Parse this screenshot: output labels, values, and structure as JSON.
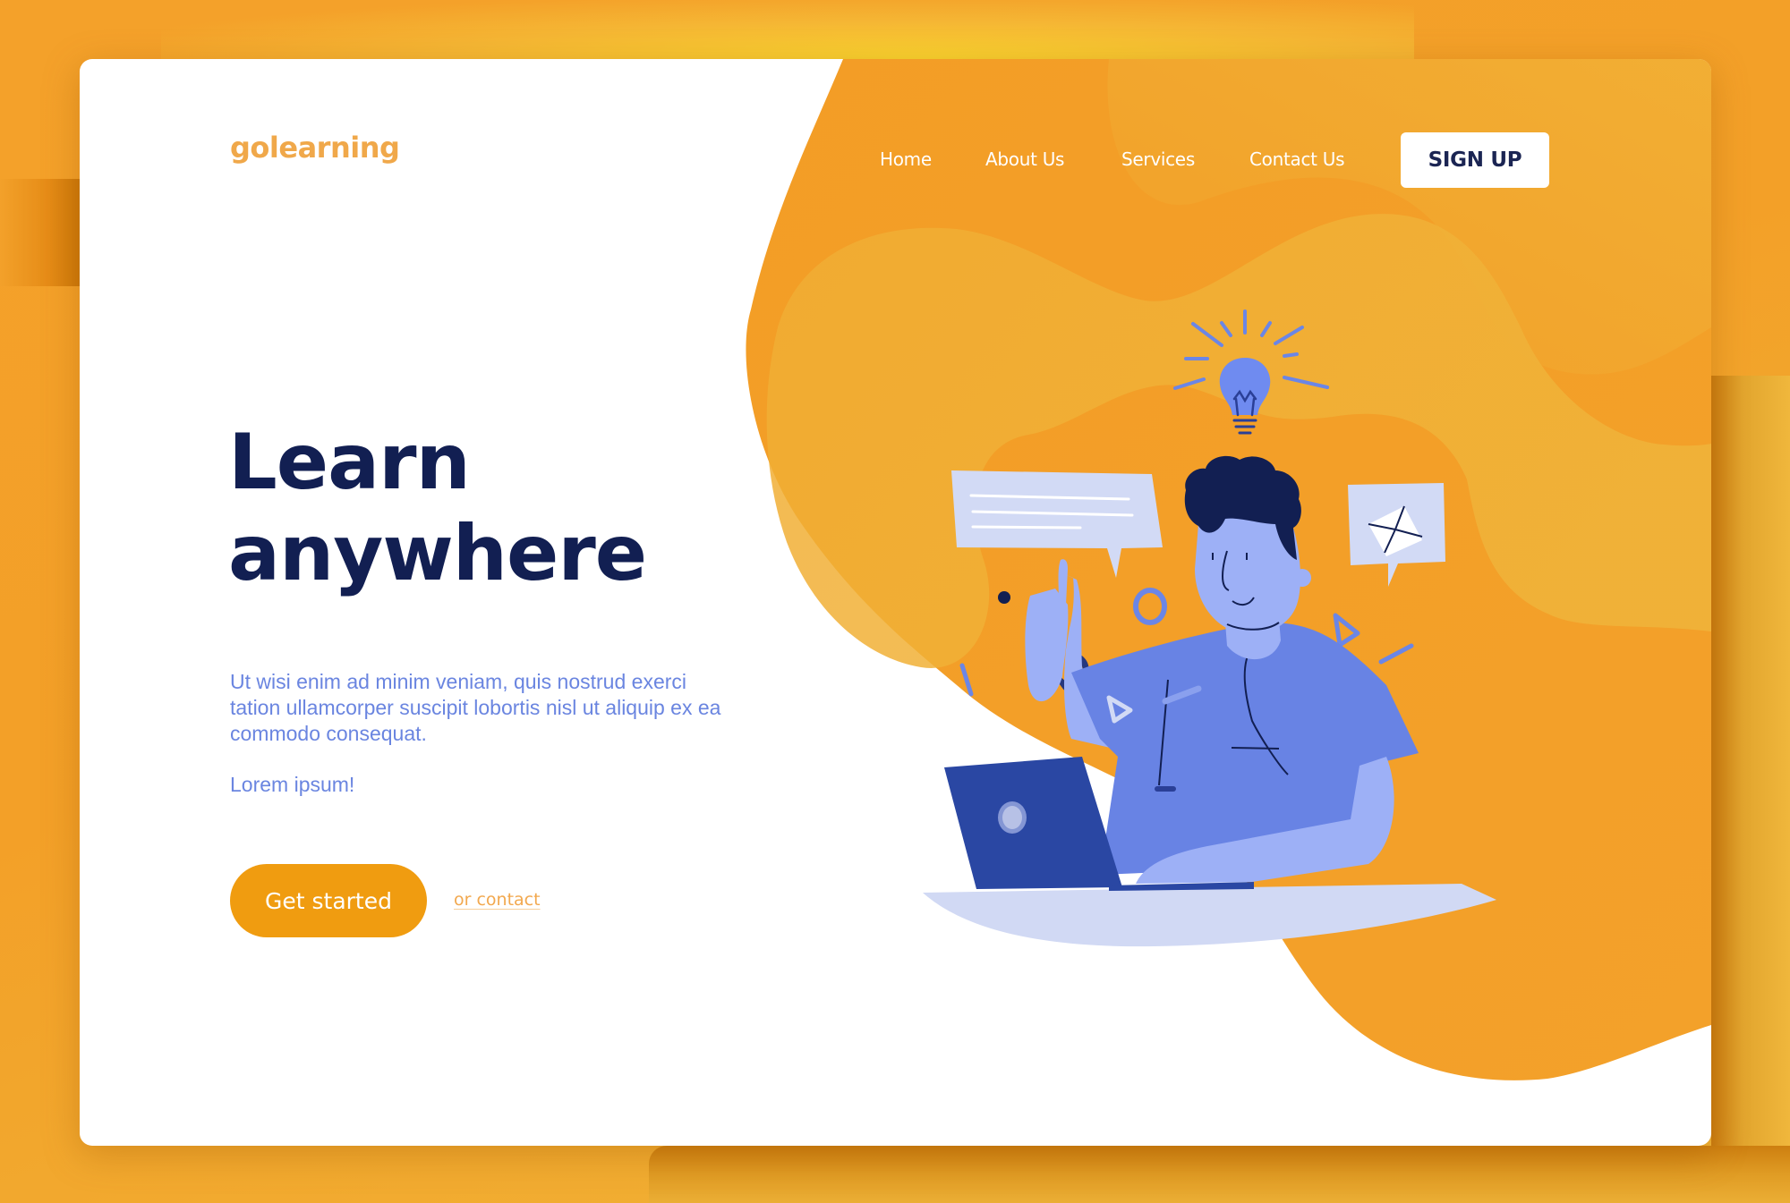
{
  "brand": {
    "name": "golearning"
  },
  "nav": {
    "items": [
      {
        "label": "Home"
      },
      {
        "label": "About Us"
      },
      {
        "label": "Services"
      },
      {
        "label": "Contact Us"
      }
    ],
    "signup_label": "SIGN UP"
  },
  "hero": {
    "title_line1": "Learn",
    "title_line2": "anywhere",
    "body": "Ut wisi enim ad minim veniam, quis nostrud exerci tation ullamcorper suscipit lobortis nisl ut aliquip ex ea commodo consequat.",
    "sub": "Lorem ipsum!",
    "cta_label": "Get started",
    "contact_label": "or contact"
  },
  "illustration": {
    "subject": "person-with-laptop-and-lightbulb",
    "icons": [
      "lightbulb-icon",
      "chat-bubble-icon",
      "envelope-icon",
      "laptop-icon"
    ]
  },
  "colors": {
    "brand_orange": "#f09c10",
    "logo_orange": "#f0a84a",
    "navy": "#121f52",
    "body_blue": "#6a85e0",
    "panel_orange": "#f3a128",
    "panel_light": "#f0b436",
    "shirt": "#6883e4",
    "skin": "#9db0f6",
    "laptop": "#2a47a3",
    "desk": "#d1d9f4"
  }
}
